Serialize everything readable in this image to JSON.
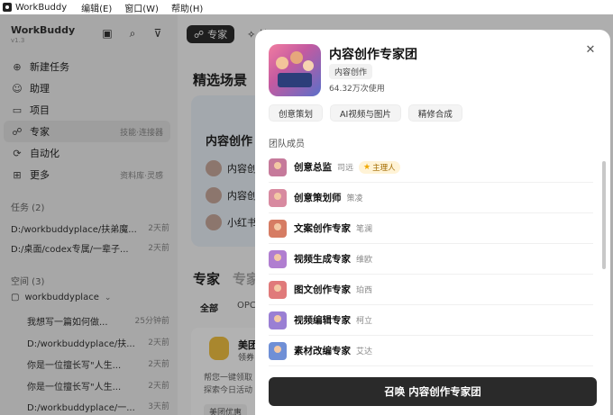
{
  "titlebar": {
    "app_name": "WorkBuddy",
    "menus": [
      "编辑(E)",
      "窗口(W)",
      "帮助(H)"
    ]
  },
  "sidebar": {
    "brand": "WorkBuddy",
    "version": "v1.3",
    "nav": [
      {
        "label": "新建任务",
        "icon": "plus-circle-icon",
        "hint": ""
      },
      {
        "label": "助理",
        "icon": "assistant-icon",
        "hint": ""
      },
      {
        "label": "项目",
        "icon": "project-icon",
        "hint": ""
      },
      {
        "label": "专家",
        "icon": "expert-icon",
        "hint": "技能·连接器"
      },
      {
        "label": "自动化",
        "icon": "automation-icon",
        "hint": ""
      },
      {
        "label": "更多",
        "icon": "more-icon",
        "hint": "资料库·灵感"
      }
    ],
    "tasks_header": "任务 (2)",
    "tasks": [
      {
        "title": "D:/workbuddyplace/扶弟魔...",
        "time": "2天前"
      },
      {
        "title": "D:/桌面/codex专属/一辈子...",
        "time": "2天前"
      }
    ],
    "spaces_header": "空间 (3)",
    "folder": "workbuddyplace",
    "space_items": [
      {
        "title": "我想写一篇如何做...",
        "time": "25分钟前"
      },
      {
        "title": "D:/workbuddyplace/扶...",
        "time": "2天前"
      },
      {
        "title": "你是一位擅长写\"人生...",
        "time": "2天前"
      },
      {
        "title": "你是一位擅长写\"人生...",
        "time": "2天前"
      },
      {
        "title": "D:/workbuddyplace/一...",
        "time": "3天前"
      }
    ]
  },
  "main": {
    "tabs": [
      "专家",
      "技"
    ],
    "section_title": "精选场景",
    "scene_title": "内容创作",
    "scene_rows": [
      "内容创",
      "内容创",
      "小红书"
    ],
    "experts_title": "专家",
    "experts_title2": "专家",
    "filter_all": "全部",
    "filter_opc": "OPC",
    "card_name": "美团",
    "card_sub": "领券",
    "card_desc1": "帮您一键领取",
    "card_desc2": "探索今日活动",
    "card_tag": "美团优惠"
  },
  "modal": {
    "title": "内容创作专家团",
    "category": "内容创作",
    "usage": "64.32万次使用",
    "skills": [
      "创意策划",
      "AI视频与图片",
      "精修合成"
    ],
    "team_header": "团队成员",
    "members": [
      {
        "role": "创意总监",
        "person": "司远",
        "lead": "主理人",
        "color": "#c67a9b"
      },
      {
        "role": "创意策划师",
        "person": "策凌",
        "lead": "",
        "color": "#d88aa0"
      },
      {
        "role": "文案创作专家",
        "person": "笔澜",
        "lead": "",
        "color": "#d67c63"
      },
      {
        "role": "视频生成专家",
        "person": "维欧",
        "lead": "",
        "color": "#b07ed0"
      },
      {
        "role": "图文创作专家",
        "person": "珀西",
        "lead": "",
        "color": "#e07a7a"
      },
      {
        "role": "视频编辑专家",
        "person": "柯立",
        "lead": "",
        "color": "#9a7fd4"
      },
      {
        "role": "素材改编专家",
        "person": "艾达",
        "lead": "",
        "color": "#6f8fd6"
      }
    ],
    "cta": "召唤 内容创作专家团"
  }
}
